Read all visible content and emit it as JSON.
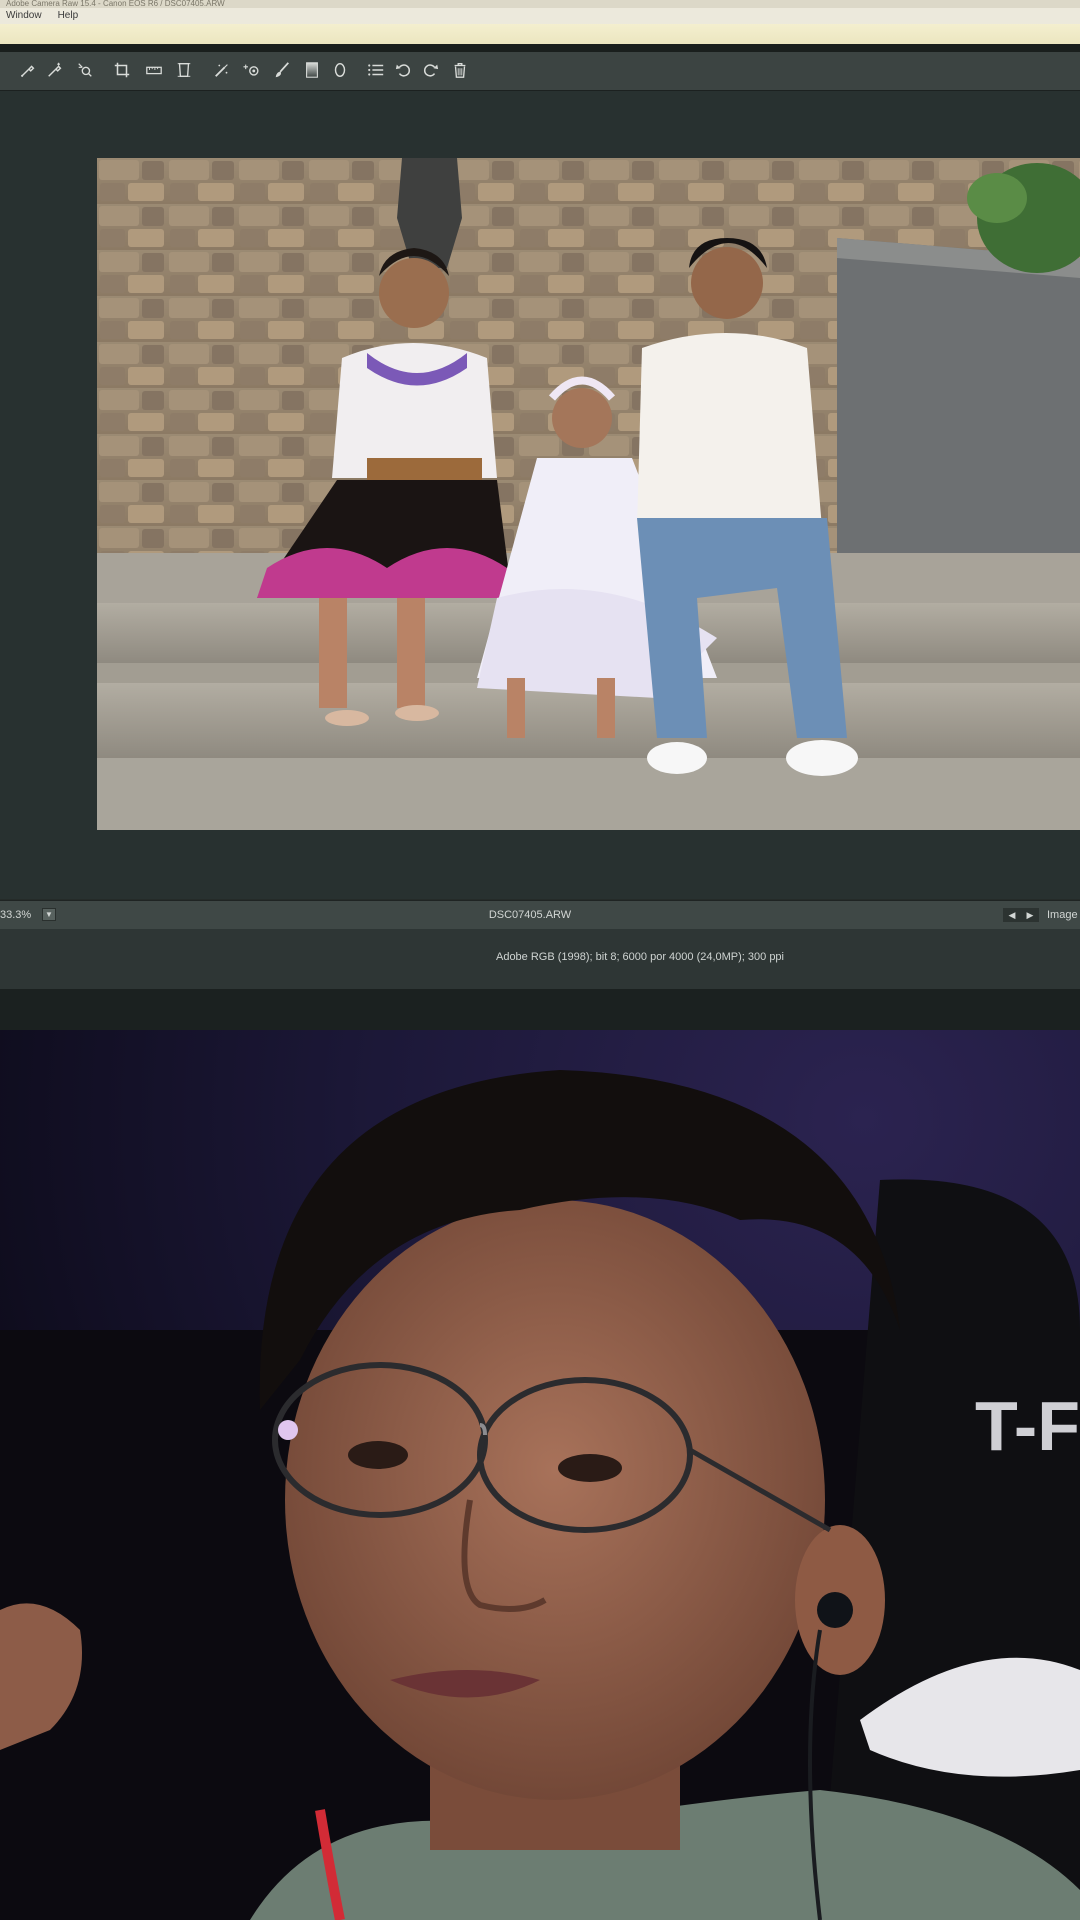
{
  "window": {
    "title_strip": "Adobe Camera Raw 15.4 - Canon EOS R6 / DSC07405.ARW",
    "menu": [
      "Window",
      "Help"
    ]
  },
  "toolbar": {
    "tools": [
      {
        "name": "white-balance-tool"
      },
      {
        "name": "color-sampler-tool"
      },
      {
        "name": "targeted-adjustment-tool"
      },
      {
        "name": "crop-tool"
      },
      {
        "name": "straighten-tool"
      },
      {
        "name": "transform-tool"
      },
      {
        "name": "spot-removal-tool"
      },
      {
        "name": "red-eye-tool"
      },
      {
        "name": "adjustment-brush-tool"
      },
      {
        "name": "graduated-filter-tool"
      },
      {
        "name": "radial-filter-tool"
      },
      {
        "name": "preferences-tool"
      },
      {
        "name": "rotate-ccw-tool"
      },
      {
        "name": "rotate-cw-tool"
      },
      {
        "name": "trash-tool"
      }
    ]
  },
  "statusbar": {
    "zoom": "33.3%",
    "filename": "DSC07405.ARW",
    "image_label": "Image"
  },
  "infobar": {
    "color_info": "Adobe RGB (1998); bit 8; 6000 por 4000 (24,0MP); 300 ppi"
  },
  "webcam": {
    "background_sign": "T-F"
  }
}
